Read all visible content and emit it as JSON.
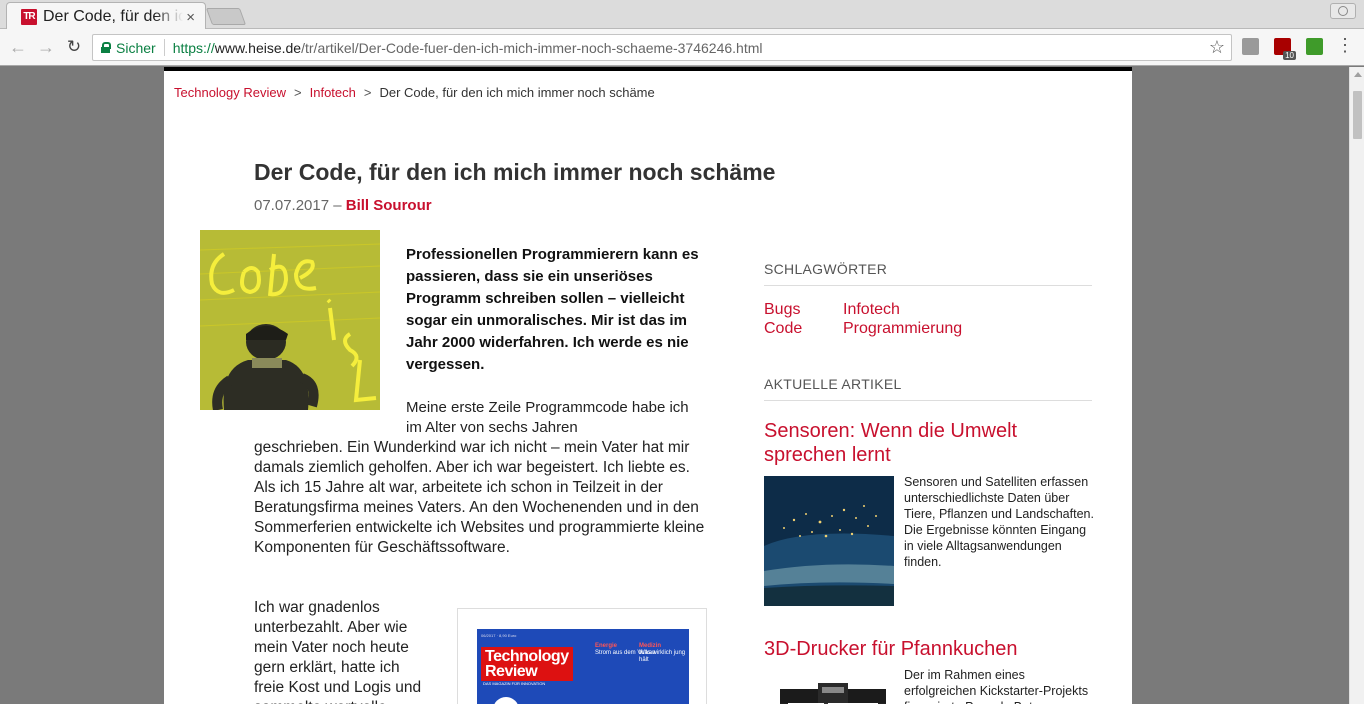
{
  "browser": {
    "tab": {
      "favicon_text": "TR",
      "title": "Der Code, für den ich mich immer noch schäme",
      "close": "×"
    },
    "omnibox": {
      "secure_label": "Sicher",
      "url_scheme": "https://",
      "url_host": "www.heise.de",
      "url_path": "/tr/artikel/Der-Code-fuer-den-ich-mich-immer-noch-schaeme-3746246.html"
    },
    "extensions": {
      "ublock_badge": "10"
    }
  },
  "breadcrumb": {
    "items": [
      "Technology Review",
      "Infotech"
    ],
    "current": "Der Code, für den ich mich immer noch schäme",
    "separator": ">"
  },
  "article": {
    "title": "Der Code, für den ich mich immer noch schäme",
    "date": "07.07.2017",
    "meta_separator": " – ",
    "author": "Bill Sourour",
    "lead": "Professionellen Programmierern kann es passieren, dass sie ein unseriöses Programm schreiben sollen – vielleicht sogar ein unmoralisches. Mir ist das im Jahr 2000 widerfahren. Ich werde es nie vergessen.",
    "p1_part1": "Meine erste Zeile Programmcode habe ich im Alter von sechs Jahren",
    "p1_part2": "geschrieben. Ein Wunderkind war ich nicht – mein Vater hat mir damals ziemlich geholfen. Aber ich war begeistert. Ich liebte es. Als ich 15 Jahre alt war, arbeitete ich schon in Teilzeit in der Beratungsfirma meines Vaters. An den Wochenenden und in den Sommerferien entwickelte ich Websites und programmierte kleine Komponenten für Geschäftssoftware.",
    "p2": "Ich war gnadenlos unterbezahlt. Aber wie mein Vater noch heute gern erklärt, hatte ich freie Kost und Logis und sammelte wertvolle"
  },
  "magazine": {
    "title_line1": "Technology",
    "title_line2": "Review",
    "subtitle": "DAS MAGAZIN FÜR INNOVATION",
    "small": "06/2017 · 8,90 Euro",
    "tag1_head": "Energie",
    "tag1_text": "Strom aus dem Vulkan",
    "tag2_head": "Medizin",
    "tag2_text": "Was wirklich jung hält"
  },
  "sidebar": {
    "tags_heading": "Schlagwörter",
    "tags": [
      "Bugs",
      "Code",
      "Infotech",
      "Programmierung"
    ],
    "recent_heading": "Aktuelle Artikel",
    "recent": [
      {
        "title": "Sensoren: Wenn die Umwelt sprechen lernt",
        "teaser": "Sensoren und Satelliten erfassen unterschiedlichste Daten über Tiere, Pflanzen und Landschaften. Die Ergebnisse könnten Eingang in viele Alltagsanwendungen finden."
      },
      {
        "title": "3D-Drucker für Pfannkuchen",
        "teaser": "Der im Rahmen eines erfolgreichen Kickstarter-Projekts finanzierte PancakeBot"
      }
    ]
  },
  "colors": {
    "brand_red": "#c8102e",
    "secure_green": "#0b8043"
  }
}
